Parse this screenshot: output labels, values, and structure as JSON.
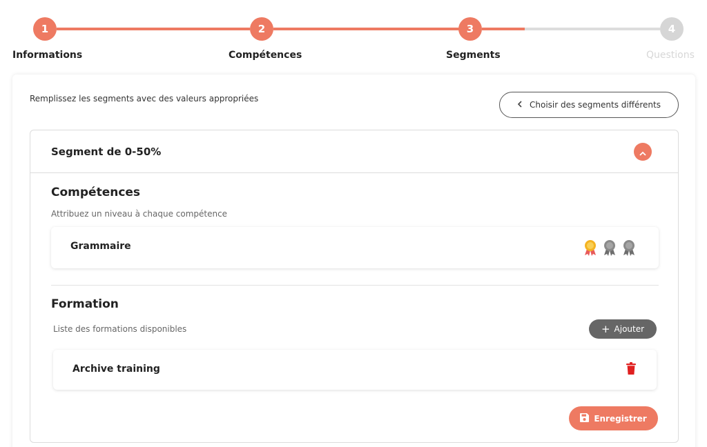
{
  "stepper": {
    "steps": [
      {
        "number": "1",
        "label": "Informations",
        "state": "active"
      },
      {
        "number": "2",
        "label": "Compétences",
        "state": "active"
      },
      {
        "number": "3",
        "label": "Segments",
        "state": "active"
      },
      {
        "number": "4",
        "label": "Questions",
        "state": "inactive"
      }
    ]
  },
  "instruction": "Remplissez les segments avec des valeurs appropriées",
  "choose_segments_label": "Choisir des segments différents",
  "segment": {
    "title": "Segment de 0-50%",
    "skills": {
      "title": "Compétences",
      "subtitle": "Attribuez un niveau à chaque compétence",
      "items": [
        {
          "label": "Grammaire",
          "level": 1,
          "max_level": 3
        }
      ]
    },
    "training": {
      "title": "Formation",
      "subtitle": "Liste des formations disponibles",
      "add_label": "Ajouter",
      "items": [
        {
          "label": "Archive training"
        }
      ]
    },
    "save_label": "Enregistrer"
  },
  "colors": {
    "accent": "#ee7a62",
    "inactive_step": "#d6d6d6",
    "medal_gold": "#f4b322",
    "medal_grey": "#8a8a8a",
    "delete_red": "#e02020",
    "add_button": "#666666"
  },
  "icons": {
    "collapse": "chevron-up-icon",
    "back": "chevron-left-icon",
    "medal": "medal-icon",
    "delete": "trash-icon",
    "add": "plus-icon",
    "save": "floppy-disk-icon"
  }
}
